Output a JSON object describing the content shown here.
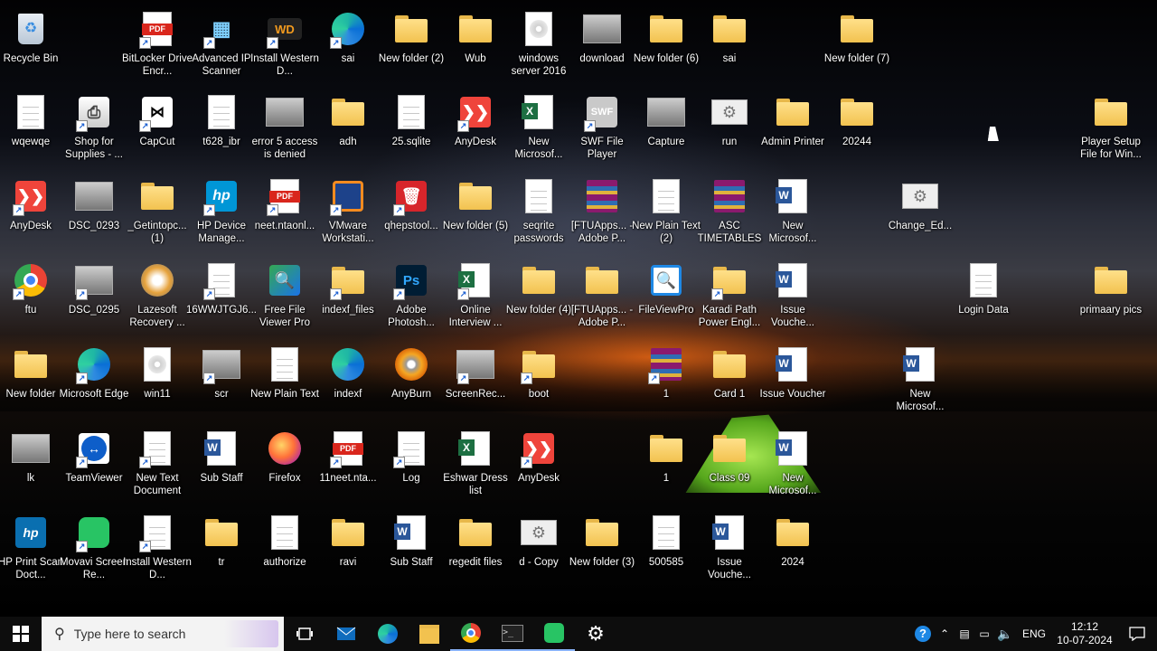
{
  "desktop": {
    "icons": [
      {
        "label": "Recycle Bin",
        "icon": "recycle-bin-icon"
      },
      {
        "label": "BitLocker Drive Encr...",
        "icon": "pdf-icon"
      },
      {
        "label": "Advanced IP Scanner",
        "icon": "network-scanner-icon"
      },
      {
        "label": "Install Western D...",
        "icon": "wd-icon"
      },
      {
        "label": "sai",
        "icon": "edge-icon"
      },
      {
        "label": "New folder (2)",
        "icon": "folder-icon"
      },
      {
        "label": "Wub",
        "icon": "folder-icon"
      },
      {
        "label": "windows server 2016",
        "icon": "disc-icon"
      },
      {
        "label": "download",
        "icon": "photo-icon"
      },
      {
        "label": "New folder (6)",
        "icon": "folder-icon"
      },
      {
        "label": "sai",
        "icon": "folder-icon"
      },
      {
        "label": "New folder (7)",
        "icon": "folder-icon"
      },
      {
        "label": "wqewqe",
        "icon": "document-icon"
      },
      {
        "label": "Shop for Supplies - ...",
        "icon": "printer-icon"
      },
      {
        "label": "CapCut",
        "icon": "capcut-icon"
      },
      {
        "label": "t628_ibr",
        "icon": "document-icon"
      },
      {
        "label": "error 5 access is denied",
        "icon": "photo-icon"
      },
      {
        "label": "adh",
        "icon": "folder-icon"
      },
      {
        "label": "25.sqlite",
        "icon": "document-icon"
      },
      {
        "label": "AnyDesk",
        "icon": "anydesk-icon"
      },
      {
        "label": "New Microsof...",
        "icon": "excel-icon"
      },
      {
        "label": "SWF File Player",
        "icon": "swf-icon"
      },
      {
        "label": "Capture",
        "icon": "photo-icon"
      },
      {
        "label": "run",
        "icon": "gear-icon"
      },
      {
        "label": "Admin Printer",
        "icon": "folder-icon"
      },
      {
        "label": "20244",
        "icon": "folder-icon"
      },
      {
        "label": "Player Setup File for Win...",
        "icon": "folder-icon"
      },
      {
        "label": "AnyDesk",
        "icon": "anydesk-icon"
      },
      {
        "label": "DSC_0293",
        "icon": "photo-icon"
      },
      {
        "label": "_Getintopc... (1)",
        "icon": "folder-icon"
      },
      {
        "label": "HP Device Manage...",
        "icon": "hp-icon"
      },
      {
        "label": "neet.ntaonl...",
        "icon": "pdf-icon"
      },
      {
        "label": "VMware Workstati...",
        "icon": "vmware-icon"
      },
      {
        "label": "qhepstool...",
        "icon": "trash-tool-icon"
      },
      {
        "label": "New folder (5)",
        "icon": "folder-icon"
      },
      {
        "label": "seqrite passwords",
        "icon": "document-icon"
      },
      {
        "label": "[FTUApps... - Adobe P...",
        "icon": "winrar-icon"
      },
      {
        "label": "New Plain Text (2)",
        "icon": "document-icon"
      },
      {
        "label": "ASC TIMETABLES",
        "icon": "winrar-icon"
      },
      {
        "label": "New Microsof...",
        "icon": "word-icon"
      },
      {
        "label": "Change_Ed...",
        "icon": "gear-icon"
      },
      {
        "label": "ftu",
        "icon": "chrome-icon"
      },
      {
        "label": "DSC_0295",
        "icon": "photo-icon"
      },
      {
        "label": "Lazesoft Recovery ...",
        "icon": "lazesoft-icon"
      },
      {
        "label": "16WWJTGJ6...",
        "icon": "document-icon"
      },
      {
        "label": "Free File Viewer Pro",
        "icon": "file-viewer-icon"
      },
      {
        "label": "indexf_files",
        "icon": "folder-icon"
      },
      {
        "label": "Adobe Photosh...",
        "icon": "photoshop-icon"
      },
      {
        "label": "Online Interview ...",
        "icon": "excel-icon"
      },
      {
        "label": "New folder (4)",
        "icon": "folder-icon"
      },
      {
        "label": "[FTUApps... - Adobe P...",
        "icon": "folder-icon"
      },
      {
        "label": "FileViewPro",
        "icon": "fileviewpro-icon"
      },
      {
        "label": "Karadi Path Power Engl...",
        "icon": "folder-icon"
      },
      {
        "label": "Issue Vouche...",
        "icon": "word-icon"
      },
      {
        "label": "Login Data",
        "icon": "document-icon"
      },
      {
        "label": "primaary pics",
        "icon": "folder-icon"
      },
      {
        "label": "New folder",
        "icon": "folder-icon"
      },
      {
        "label": "Microsoft Edge",
        "icon": "edge-icon"
      },
      {
        "label": "win11",
        "icon": "disc-icon"
      },
      {
        "label": "scr",
        "icon": "photo-icon"
      },
      {
        "label": "New Plain Text",
        "icon": "document-icon"
      },
      {
        "label": "indexf",
        "icon": "edge-icon"
      },
      {
        "label": "AnyBurn",
        "icon": "anyburn-icon"
      },
      {
        "label": "ScreenRec...",
        "icon": "photo-icon"
      },
      {
        "label": "boot",
        "icon": "folder-icon"
      },
      {
        "label": "1",
        "icon": "winrar-icon"
      },
      {
        "label": "Card 1",
        "icon": "folder-icon"
      },
      {
        "label": "Issue Voucher",
        "icon": "word-icon"
      },
      {
        "label": "New Microsof...",
        "icon": "word-icon"
      },
      {
        "label": "lk",
        "icon": "photo-icon"
      },
      {
        "label": "TeamViewer",
        "icon": "teamviewer-icon"
      },
      {
        "label": "New Text Document",
        "icon": "document-icon"
      },
      {
        "label": "Sub Staff",
        "icon": "word-icon"
      },
      {
        "label": "Firefox",
        "icon": "firefox-icon"
      },
      {
        "label": "11neet.nta...",
        "icon": "pdf-icon"
      },
      {
        "label": "Log",
        "icon": "document-icon"
      },
      {
        "label": "Eshwar Dress list",
        "icon": "excel-icon"
      },
      {
        "label": "AnyDesk",
        "icon": "anydesk-icon"
      },
      {
        "label": "1",
        "icon": "folder-icon"
      },
      {
        "label": "Class 09",
        "icon": "folder-icon"
      },
      {
        "label": "New Microsof...",
        "icon": "word-icon"
      },
      {
        "label": "HP Print Scan Doct...",
        "icon": "hp-scan-icon"
      },
      {
        "label": "Movavi Screen Re...",
        "icon": "movavi-icon"
      },
      {
        "label": "Install Western D...",
        "icon": "document-icon"
      },
      {
        "label": "tr",
        "icon": "folder-icon"
      },
      {
        "label": "authorize",
        "icon": "document-icon"
      },
      {
        "label": "ravi",
        "icon": "folder-icon"
      },
      {
        "label": "Sub Staff",
        "icon": "word-icon"
      },
      {
        "label": "regedit files",
        "icon": "folder-icon"
      },
      {
        "label": "d - Copy",
        "icon": "gear-icon"
      },
      {
        "label": "New folder (3)",
        "icon": "folder-icon"
      },
      {
        "label": "500585",
        "icon": "document-icon"
      },
      {
        "label": "Issue Vouche...",
        "icon": "word-icon"
      },
      {
        "label": "2024",
        "icon": "folder-icon"
      }
    ]
  },
  "taskbar": {
    "search_placeholder": "Type here to search",
    "language": "ENG",
    "time": "12:12",
    "date": "10-07-2024"
  }
}
